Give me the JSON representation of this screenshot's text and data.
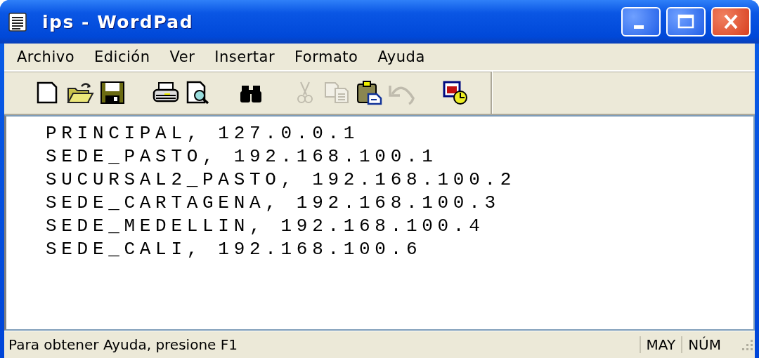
{
  "window": {
    "title": "ips - WordPad"
  },
  "menu": [
    "Archivo",
    "Edición",
    "Ver",
    "Insertar",
    "Formato",
    "Ayuda"
  ],
  "toolbar": [
    {
      "kind": "new",
      "disabled": false
    },
    {
      "kind": "open",
      "disabled": false
    },
    {
      "kind": "save",
      "disabled": false
    },
    {
      "kind": "sep"
    },
    {
      "kind": "print",
      "disabled": false
    },
    {
      "kind": "preview",
      "disabled": false
    },
    {
      "kind": "sep"
    },
    {
      "kind": "find",
      "disabled": false
    },
    {
      "kind": "sep"
    },
    {
      "kind": "cut",
      "disabled": true
    },
    {
      "kind": "copy",
      "disabled": true
    },
    {
      "kind": "paste",
      "disabled": false
    },
    {
      "kind": "undo",
      "disabled": true
    },
    {
      "kind": "sep"
    },
    {
      "kind": "datetime",
      "disabled": false
    }
  ],
  "document": {
    "lines": [
      "PRINCIPAL, 127.0.0.1",
      "SEDE_PASTO, 192.168.100.1",
      "SUCURSAL2_PASTO, 192.168.100.2",
      "SEDE_CARTAGENA, 192.168.100.3",
      "SEDE_MEDELLIN, 192.168.100.4",
      "SEDE_CALI, 192.168.100.6"
    ]
  },
  "status_bar": {
    "message": "Para obtener Ayuda, presione F1",
    "indicators": [
      "MAY",
      "NÚM"
    ]
  }
}
